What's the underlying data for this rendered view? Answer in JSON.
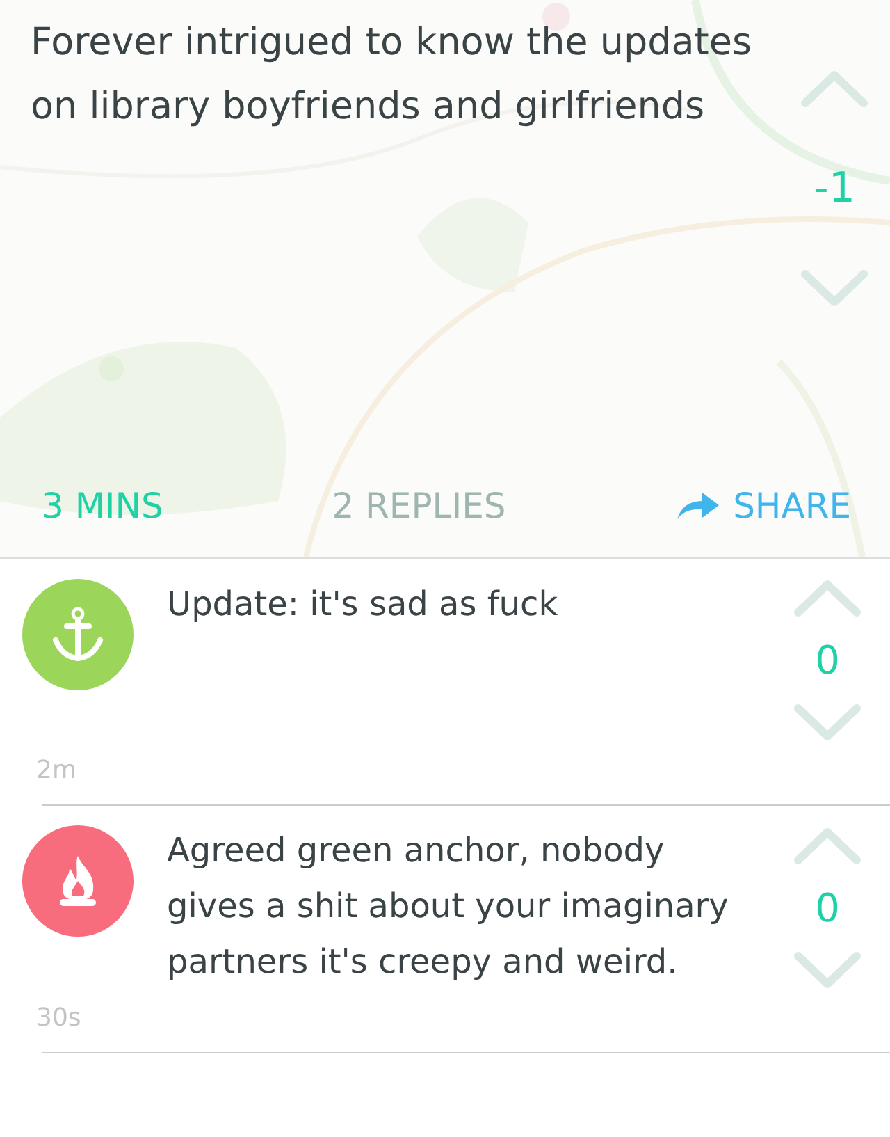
{
  "post": {
    "text": "Forever intrigued to know the updates on library boyfriends and girlfriends",
    "score": "-1",
    "time": "3 MINS",
    "replies_count": "2 REPLIES",
    "share": "SHARE"
  },
  "replies": [
    {
      "text": "Update: it's sad as fuck",
      "score": "0",
      "time": "2m",
      "avatar": {
        "color": "#9bd65a",
        "kind": "anchor"
      }
    },
    {
      "text": "Agreed green anchor, nobody gives a shit about your imaginary partners it's creepy and weird.",
      "score": "0",
      "time": "30s",
      "avatar": {
        "color": "#f76d7d",
        "kind": "fire"
      }
    }
  ]
}
